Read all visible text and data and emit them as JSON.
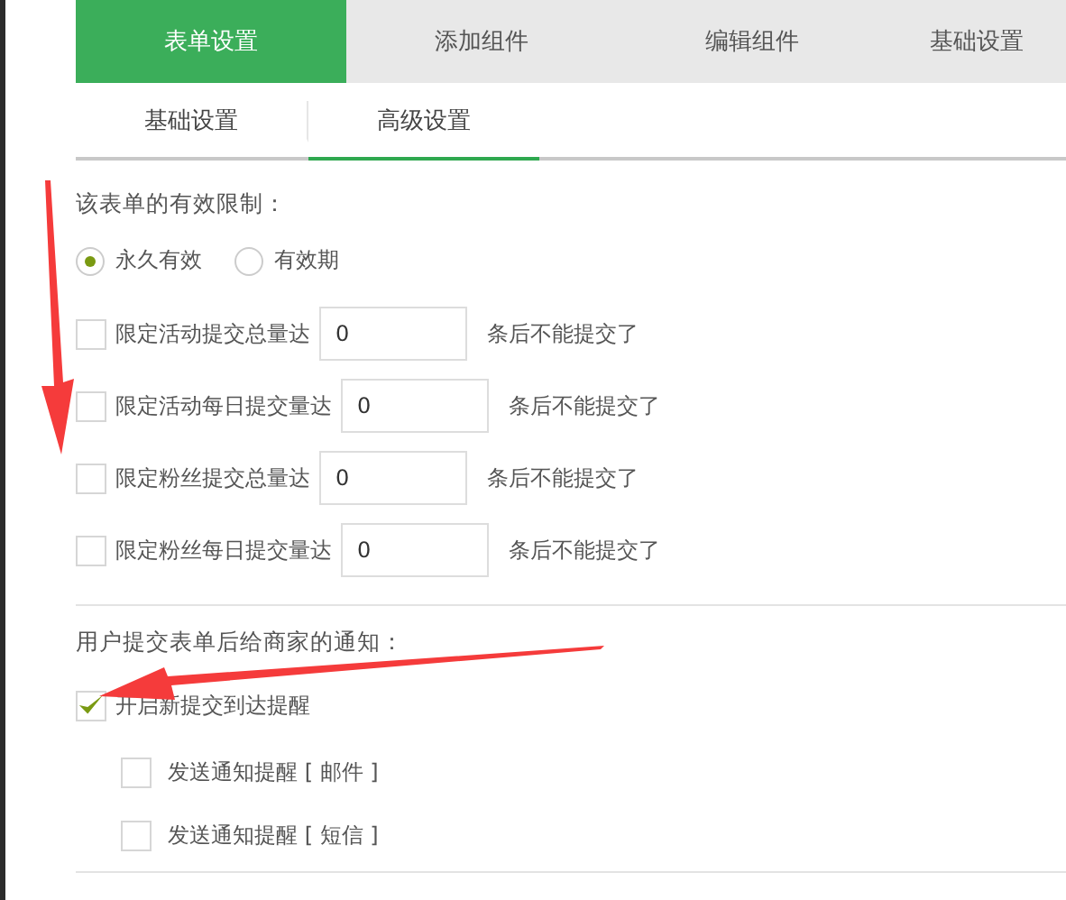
{
  "tabs": [
    {
      "label": "表单设置",
      "selected": true
    },
    {
      "label": "添加组件",
      "selected": false
    },
    {
      "label": "编辑组件",
      "selected": false
    },
    {
      "label": "基础设置",
      "selected": false
    }
  ],
  "subtabs": [
    {
      "label": "基础设置",
      "selected": false
    },
    {
      "label": "高级设置",
      "selected": true
    }
  ],
  "validity": {
    "label": "该表单的有效限制：",
    "options": [
      {
        "label": "永久有效",
        "selected": true
      },
      {
        "label": "有效期",
        "selected": false
      }
    ]
  },
  "limits": [
    {
      "label": "限定活动提交总量达",
      "value": "0",
      "suffix": "条后不能提交了",
      "checked": false
    },
    {
      "label": "限定活动每日提交量达",
      "value": "0",
      "suffix": "条后不能提交了",
      "checked": false
    },
    {
      "label": "限定粉丝提交总量达",
      "value": "0",
      "suffix": "条后不能提交了",
      "checked": false
    },
    {
      "label": "限定粉丝每日提交量达",
      "value": "0",
      "suffix": "条后不能提交了",
      "checked": false
    }
  ],
  "notification": {
    "label": "用户提交表单后给商家的通知：",
    "items": [
      {
        "label": "开启新提交到达提醒",
        "checked": true,
        "children": [
          {
            "label": "发送通知提醒 [ 邮件 ]",
            "checked": false
          },
          {
            "label": "发送通知提醒 [ 短信 ]",
            "checked": false
          }
        ]
      }
    ]
  }
}
